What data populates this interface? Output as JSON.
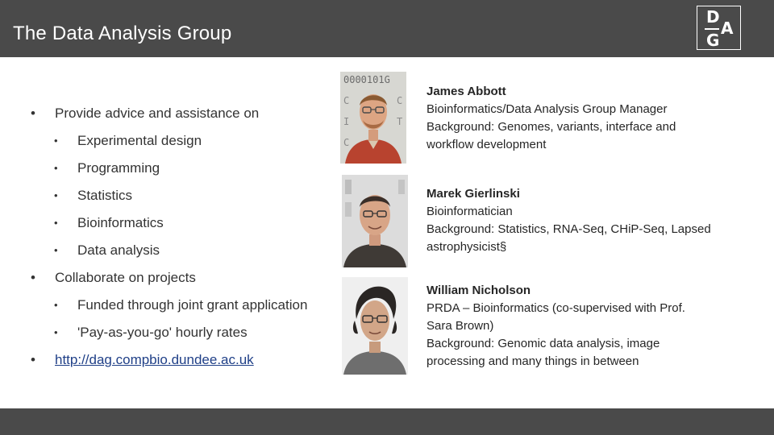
{
  "header": {
    "title": "The Data Analysis Group",
    "logo_letters": {
      "d": "D",
      "a": "A",
      "g": "G"
    }
  },
  "bullets": [
    {
      "level": 1,
      "text": "Provide advice and assistance on",
      "link": false
    },
    {
      "level": 2,
      "text": "Experimental design",
      "link": false
    },
    {
      "level": 2,
      "text": "Programming",
      "link": false
    },
    {
      "level": 2,
      "text": "Statistics",
      "link": false
    },
    {
      "level": 2,
      "text": "Bioinformatics",
      "link": false
    },
    {
      "level": 2,
      "text": "Data analysis",
      "link": false
    },
    {
      "level": 1,
      "text": "Collaborate on projects",
      "link": false
    },
    {
      "level": 2,
      "text": "Funded through joint grant application",
      "link": false
    },
    {
      "level": 2,
      "text": "'Pay-as-you-go' hourly rates",
      "link": false
    },
    {
      "level": 1,
      "text": "http://dag.compbio.dundee.ac.uk",
      "link": true
    }
  ],
  "people": [
    {
      "name": "James Abbott",
      "lines": [
        "Bioinformatics/Data Analysis Group Manager",
        "Background: Genomes, variants, interface and",
        "workflow development"
      ]
    },
    {
      "name": "Marek Gierlinski",
      "lines": [
        "Bioinformatician",
        "Background: Statistics, RNA-Seq, CHiP-Seq, Lapsed",
        "astrophysicist§"
      ]
    },
    {
      "name": "William Nicholson",
      "lines": [
        "PRDA – Bioinformatics (co-supervised with Prof.",
        "Sara Brown)",
        "Background: Genomic data analysis, image",
        "processing and many things in between"
      ]
    }
  ],
  "photo_text": {
    "binary_strip": "0000101G"
  },
  "colors": {
    "bar": "#4a4a4a",
    "title_text": "#ffffff",
    "body_text": "#333333",
    "link": "#1f3f87"
  }
}
